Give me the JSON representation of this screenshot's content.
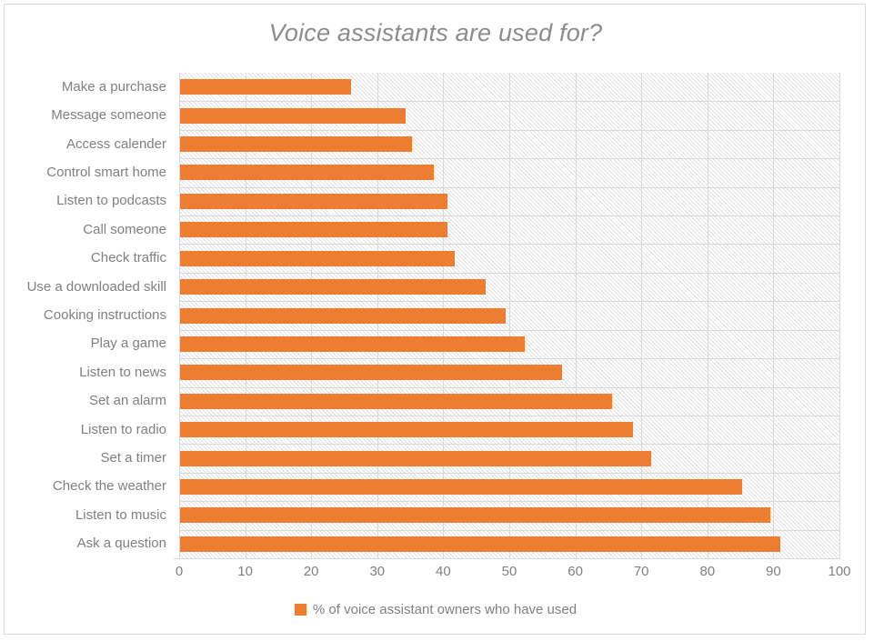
{
  "chart": {
    "title": "Voice assistants are used for?",
    "accent_color": "#ED7D31",
    "text_color": "#808080",
    "gridline_color": "#D9D9D9",
    "border_color": "#D9D9D9",
    "legend": {
      "label": "% of voice assistant owners who have used",
      "position": "bottom",
      "marker": "square-swatch"
    }
  },
  "chart_data": {
    "type": "bar",
    "orientation": "horizontal",
    "title": "Voice assistants are used for?",
    "xlabel": "",
    "ylabel": "",
    "xlim": [
      0,
      100
    ],
    "xticks": [
      0,
      10,
      20,
      30,
      40,
      50,
      60,
      70,
      80,
      90,
      100
    ],
    "grid": true,
    "grid_axis": "x",
    "legend_position": "bottom",
    "series": [
      {
        "name": "% of voice assistant owners who have used",
        "color": "#ED7D31",
        "values": [
          26,
          34.3,
          35.3,
          38.5,
          40.6,
          40.6,
          41.7,
          46.4,
          49.5,
          52.3,
          58,
          65.6,
          68.8,
          71.5,
          85.2,
          89.5,
          91
        ]
      }
    ],
    "categories": [
      "Make a purchase",
      "Message someone",
      "Access calender",
      "Control smart home",
      "Listen to podcasts",
      "Call someone",
      "Check traffic",
      "Use a downloaded skill",
      "Cooking instructions",
      "Play a game",
      "Listen to news",
      "Set an alarm",
      "Listen to radio",
      "Set a timer",
      "Check the weather",
      "Listen to music",
      "Ask a question"
    ]
  }
}
